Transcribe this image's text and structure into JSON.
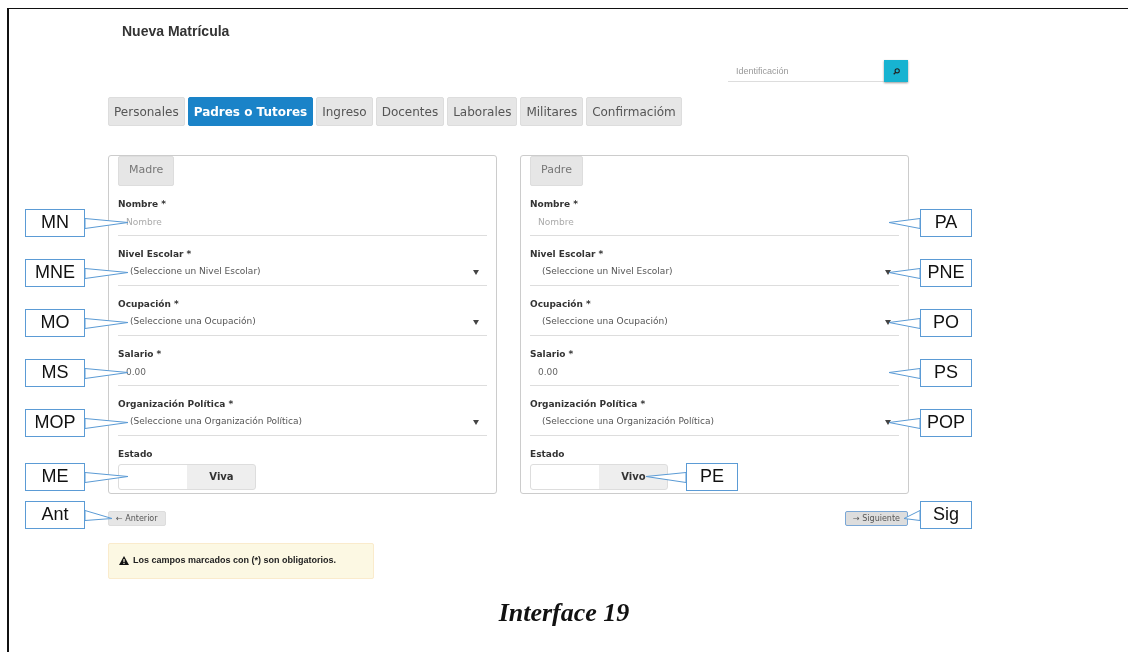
{
  "title": "Nueva Matrícula",
  "search": {
    "placeholder": "Identificación"
  },
  "tabs": [
    {
      "label": "Personales",
      "selected": false
    },
    {
      "label": "Padres o Tutores",
      "selected": true
    },
    {
      "label": "Ingreso",
      "selected": false
    },
    {
      "label": "Docentes",
      "selected": false
    },
    {
      "label": "Laborales",
      "selected": false
    },
    {
      "label": "Militares",
      "selected": false
    },
    {
      "label": "Confirmacióm",
      "selected": false
    }
  ],
  "panels": [
    {
      "legend": "Madre",
      "fields": [
        {
          "kind": "text",
          "label": "Nombre *",
          "placeholder": "Nombre",
          "callout": {
            "text": "MN",
            "kind": "left"
          }
        },
        {
          "kind": "select",
          "label": "Nivel Escolar *",
          "value": "(Seleccione un Nivel Escolar)",
          "callout": {
            "text": "MNE",
            "kind": "left"
          }
        },
        {
          "kind": "select",
          "label": "Ocupación *",
          "value": "(Seleccione una Ocupación)",
          "callout": {
            "text": "MO",
            "kind": "left"
          }
        },
        {
          "kind": "text",
          "label": "Salario *",
          "value": "0.00",
          "callout": {
            "text": "MS",
            "kind": "left"
          }
        },
        {
          "kind": "select",
          "label": "Organización Política *",
          "value": "(Seleccione una Organización Política)",
          "callout": {
            "text": "MOP",
            "kind": "left"
          }
        },
        {
          "kind": "toggle",
          "label": "Estado",
          "value": "Viva",
          "callout": {
            "text": "ME",
            "kind": "left"
          }
        }
      ]
    },
    {
      "legend": "Padre",
      "fields": [
        {
          "kind": "text",
          "label": "Nombre *",
          "placeholder": "Nombre",
          "callout": {
            "text": "PA",
            "kind": "right"
          }
        },
        {
          "kind": "select",
          "label": "Nivel Escolar *",
          "value": "(Seleccione un Nivel Escolar)",
          "callout": {
            "text": "PNE",
            "kind": "right"
          }
        },
        {
          "kind": "select",
          "label": "Ocupación *",
          "value": "(Seleccione una Ocupación)",
          "callout": {
            "text": "PO",
            "kind": "right"
          }
        },
        {
          "kind": "text",
          "label": "Salario *",
          "value": "0.00",
          "callout": {
            "text": "PS",
            "kind": "right"
          }
        },
        {
          "kind": "select",
          "label": "Organización Política *",
          "value": "(Seleccione una Organización Política)",
          "callout": {
            "text": "POP",
            "kind": "right"
          }
        },
        {
          "kind": "toggle",
          "label": "Estado",
          "value": "Vivo",
          "callout": {
            "text": "PE",
            "kind": "beside"
          }
        }
      ]
    }
  ],
  "nav_buttons": [
    {
      "icon": "←",
      "label": "Anterior",
      "focused": false,
      "callout": {
        "text": "Ant",
        "kind": "left"
      }
    },
    {
      "icon": "→",
      "label": "Siguiente",
      "focused": true,
      "callout": {
        "text": "Sig",
        "kind": "right"
      }
    }
  ],
  "alert": {
    "text": "Los campos marcados con (*) son obligatorios."
  },
  "caption": "Interface 19"
}
